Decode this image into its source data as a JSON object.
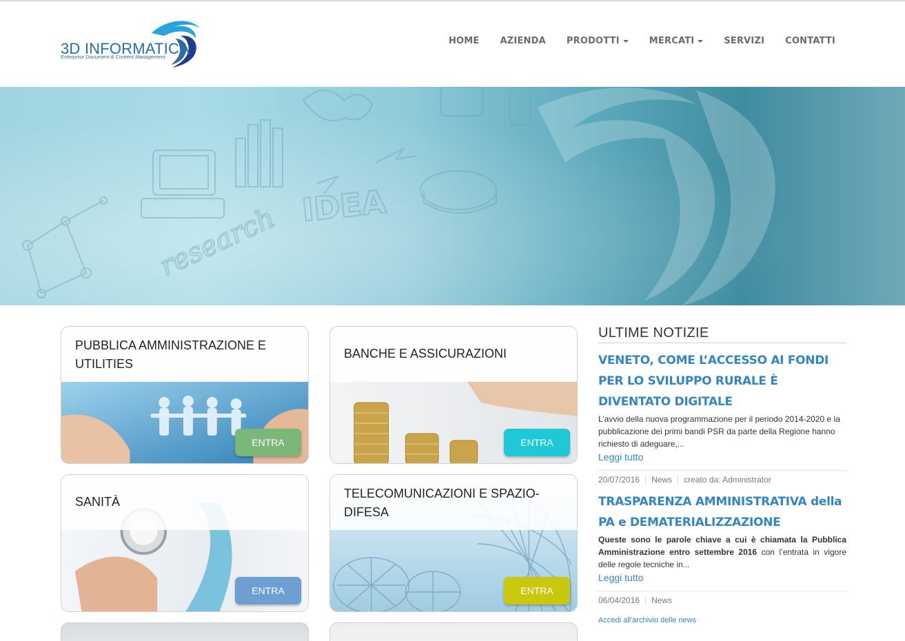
{
  "brand": {
    "name": "3D INFORMATICA",
    "tagline": "Enterprise Document & Content Management",
    "accent_color": "#2a6da6"
  },
  "nav": {
    "items": [
      {
        "label": "HOME",
        "dropdown": false
      },
      {
        "label": "AZIENDA",
        "dropdown": false
      },
      {
        "label": "PRODOTTI",
        "dropdown": true
      },
      {
        "label": "MERCATI",
        "dropdown": true
      },
      {
        "label": "SERVIZI",
        "dropdown": false
      },
      {
        "label": "CONTATTI",
        "dropdown": false
      }
    ]
  },
  "hero": {
    "sketch_words": [
      "IDEA",
      "research"
    ]
  },
  "markets": [
    {
      "title": "PUBBLICA AMMINISTRAZIONE E UTILITIES",
      "button": "ENTRA",
      "button_color": "#7cb678"
    },
    {
      "title": "BANCHE E ASSICURAZIONI",
      "button": "ENTRA",
      "button_color": "#1ec8d6"
    },
    {
      "title": "SANITÀ",
      "button": "ENTRA",
      "button_color": "#6e9fd3"
    },
    {
      "title": "TELECOMUNICAZIONI E SPAZIO-DIFESA",
      "button": "ENTRA",
      "button_color": "#c9c80f"
    }
  ],
  "news": {
    "heading": "ULTIME NOTIZIE",
    "items": [
      {
        "title": "VENETO, COME L’ACCESSO AI FONDI PER LO SVILUPPO RURALE È DIVENTATO DIGITALE",
        "body": "L’avvio della nuova programmazione per il periodo 2014-2020 e la pubblicazione dei primi bandi PSR da parte della Regione hanno richiesto di adeguare,...",
        "read_more": "Leggi tutto",
        "date": "20/07/2016",
        "category": "News",
        "author": "creato da: Administrator"
      },
      {
        "title": "TRASPARENZA AMMINISTRATIVA della PA e DEMATERIALIZZAZIONE",
        "body_bold": "Queste sono le parole chiave a cui è chiamata la Pubblica Amministrazione entro settembre 2016",
        "body_rest": " con l’entrata in vigore delle regole tecniche in...",
        "read_more": "Leggi tutto",
        "date": "06/04/2016",
        "category": "News"
      }
    ],
    "archive_link": "Accedi all'archivio delle news",
    "link_color": "#3386c1"
  }
}
